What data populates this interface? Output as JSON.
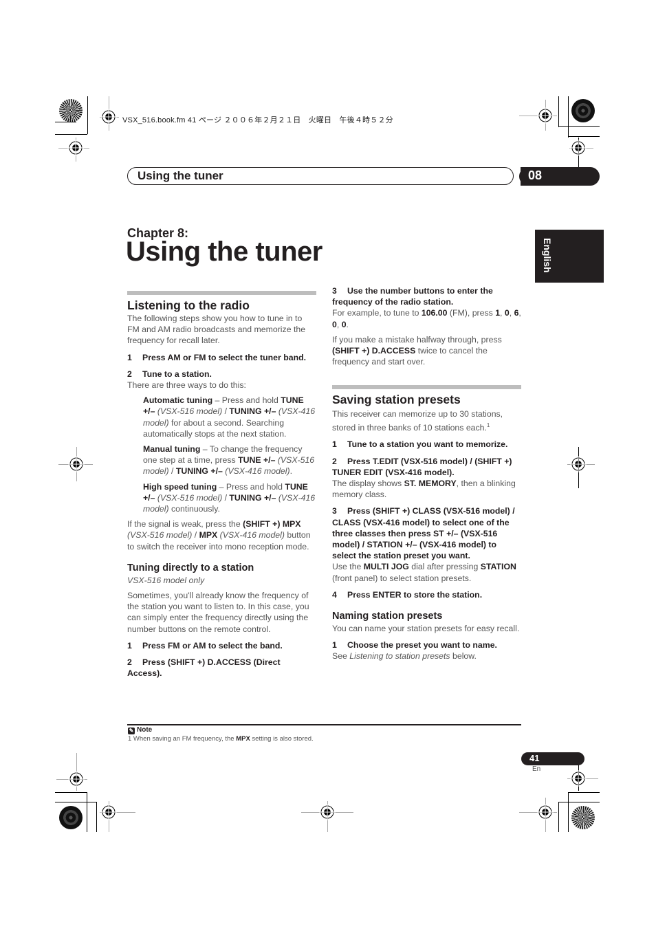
{
  "print_header": {
    "file_info": "VSX_516.book.fm  41 ページ  ２００６年２月２１日　火曜日　午後４時５２分"
  },
  "header": {
    "section_title": "Using the tuner",
    "chapter_number": "08"
  },
  "chapter": {
    "label": "Chapter 8:",
    "title": "Using the tuner"
  },
  "language_tab": "English",
  "left_column": {
    "listening": {
      "heading": "Listening to the radio",
      "intro": "The following steps show you how to tune in to FM and AM radio broadcasts and memorize the frequency for recall later.",
      "step1": {
        "num": "1",
        "text": "Press AM or FM to select the tuner band."
      },
      "step2": {
        "num": "2",
        "text": "Tune to a station."
      },
      "step2_body": "There are three ways to do this:",
      "auto": {
        "label": "Automatic tuning",
        "t1": " – Press and hold ",
        "k1": "TUNE +/–",
        "m1": " (VSX-516 model)",
        "t2": " / ",
        "k2": "TUNING +/–",
        "m2": " (VSX-416 model)",
        "t3": " for about a second. Searching automatically stops at the next station."
      },
      "manual": {
        "label": "Manual tuning",
        "t1": " – To change the frequency one step at a time, press ",
        "k1": "TUNE +/–",
        "m1": " (VSX-516 model)",
        "t2": " / ",
        "k2": "TUNING +/–",
        "m2": " (VSX-416 model)",
        "t3": "."
      },
      "highspeed": {
        "label": "High speed tuning",
        "t1": " – Press and hold ",
        "k1": "TUNE +/–",
        "m1": " (VSX-516 model)",
        "t2": " / ",
        "k2": "TUNING +/–",
        "m2": " (VSX-416 model)",
        "t3": " continuously."
      },
      "weak": {
        "t1": "If the signal is weak, press the ",
        "k1": "(SHIFT +) MPX",
        "m1": " (VSX-516 model)",
        "t2": " / ",
        "k2": "MPX",
        "m2": " (VSX-416 model)",
        "t3": " button to switch the receiver into mono reception mode."
      }
    },
    "direct": {
      "heading": "Tuning directly to a station",
      "subtitle": "VSX-516 model only",
      "body": "Sometimes, you'll already know the frequency of the station you want to listen to. In this case, you can simply enter the frequency directly using the number buttons on the remote control.",
      "step1": {
        "num": "1",
        "text": "Press FM or AM to select the band."
      },
      "step2": {
        "num": "2",
        "text": "Press (SHIFT +) D.ACCESS (Direct Access)."
      }
    }
  },
  "right_column": {
    "direct_cont": {
      "step3": {
        "num": "3",
        "text": "Use the number buttons to enter the frequency of the radio station."
      },
      "example": {
        "t1": "For example, to tune to ",
        "k1": "106.00",
        "t2": " (FM), press ",
        "k2": "1",
        "k3": "0",
        "k4": "6",
        "k5": "0",
        "k6": "0",
        "sep": ", ",
        "end": "."
      },
      "mistake": {
        "t1": "If you make a mistake halfway through, press ",
        "k1": "(SHIFT +) D.ACCESS",
        "t2": " twice to cancel the frequency and start over."
      }
    },
    "saving": {
      "heading": "Saving station presets",
      "intro": "This receiver can memorize up to 30 stations, stored in three banks of 10 stations each.",
      "footnote_ref": "1",
      "step1": {
        "num": "1",
        "text": "Tune to a station you want to memorize."
      },
      "step2": {
        "num": "2",
        "text": "Press T.EDIT (VSX-516 model) / (SHIFT +) TUNER EDIT (VSX-416 model)."
      },
      "step2_body": {
        "t1": "The display shows ",
        "k1": "ST. MEMORY",
        "t2": ", then a blinking memory class."
      },
      "step3": {
        "num": "3",
        "text": "Press (SHIFT +) CLASS (VSX-516 model) / CLASS (VSX-416 model) to select one of the three classes then press ST +/– (VSX-516 model) / STATION +/– (VSX-416 model) to select the station preset you want."
      },
      "step3_body": {
        "t1": "Use the ",
        "k1": "MULTI JOG",
        "t2": " dial after pressing ",
        "k2": "STATION",
        "t3": " (front panel) to select station presets."
      },
      "step4": {
        "num": "4",
        "text": "Press ENTER to store the station."
      }
    },
    "naming": {
      "heading": "Naming station presets",
      "intro": "You can name your station presets for easy recall.",
      "step1": {
        "num": "1",
        "text": "Choose the preset you want to name."
      },
      "step1_body": {
        "t1": "See ",
        "link": "Listening to station presets",
        "t2": " below."
      }
    }
  },
  "note": {
    "icon": "pencil-note-icon",
    "label": "Note",
    "num": "1",
    "t1": " When saving an FM frequency, the ",
    "k1": "MPX",
    "t2": " setting is also stored."
  },
  "footer": {
    "page_number": "41",
    "language_code": "En"
  }
}
